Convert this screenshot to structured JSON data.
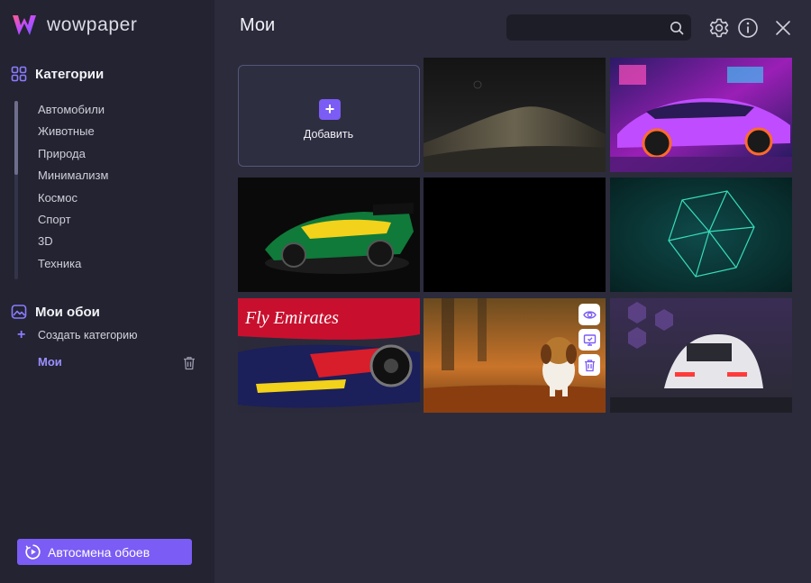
{
  "app": {
    "name": "wowpaper"
  },
  "sidebar": {
    "categories_title": "Категории",
    "categories": [
      "Автомобили",
      "Животные",
      "Природа",
      "Минимализм",
      "Космос",
      "Спорт",
      "3D",
      "Техника"
    ],
    "my_wallpapers_title": "Мои обои",
    "create_category_label": "Создать категорию",
    "my_items": [
      {
        "label": "Мои"
      }
    ],
    "auto_change_label": "Автосмена обоев"
  },
  "header": {
    "title": "Мои",
    "search": {
      "placeholder": "",
      "value": ""
    }
  },
  "grid": {
    "add_label": "Добавить",
    "tile_actions": [
      "eye-icon",
      "set-wallpaper-icon",
      "trash-icon"
    ],
    "fbsimg_text": "Fly Emirates"
  },
  "colors": {
    "accent": "#7b5cf5",
    "sidebar_bg": "#232331",
    "main_bg": "#2b2b3c"
  }
}
